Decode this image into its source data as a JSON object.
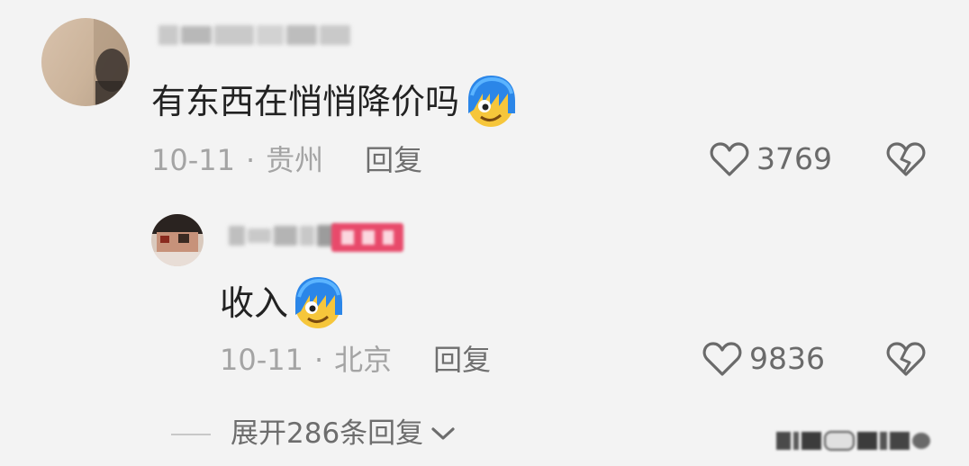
{
  "comments": [
    {
      "text": "有东西在悄悄降价吗",
      "emoji": "smirk-emoji",
      "date": "10-11",
      "separator": "·",
      "location": "贵州",
      "reply_label": "回复",
      "likes": "3769"
    }
  ],
  "reply": {
    "text": "收入",
    "emoji": "smirk-emoji",
    "date": "10-11",
    "separator": "·",
    "location": "北京",
    "reply_label": "回复",
    "likes": "9836"
  },
  "expand_label": "展开286条回复",
  "colors": {
    "background": "#f3f3f3",
    "text": "#222222",
    "meta": "#a4a4a4",
    "badge": "#e84a6b"
  },
  "icons": [
    "heart-outline-icon",
    "broken-heart-icon",
    "chevron-down-icon"
  ]
}
